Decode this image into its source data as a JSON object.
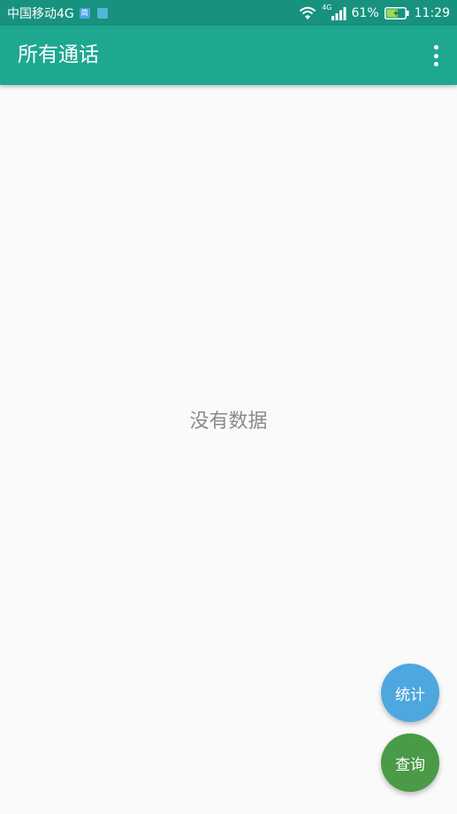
{
  "status_bar": {
    "carrier": "中国移动4G",
    "badge1": "简",
    "badge2": "",
    "network_label": "4G",
    "battery_percent": "61%",
    "time": "11:29",
    "battery_level": 0.61
  },
  "toolbar": {
    "title": "所有通话"
  },
  "main": {
    "empty_text": "没有数据"
  },
  "fabs": {
    "stats_label": "统计",
    "query_label": "查询"
  },
  "colors": {
    "status_bar_bg": "#17927e",
    "toolbar_bg": "#1ea890",
    "stats_fab": "#4ea7de",
    "query_fab": "#4a9a47"
  }
}
